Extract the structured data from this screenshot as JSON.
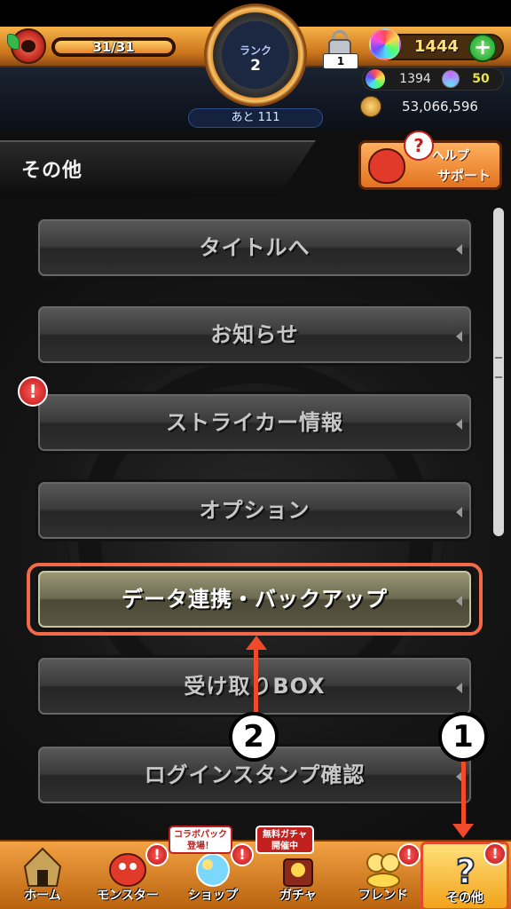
{
  "status": {
    "stamina": "31/31",
    "stamina_fraction": 1.0,
    "rank_label": "ランク",
    "rank_value": "2",
    "next_rank": "あと 111",
    "lock_count": "1",
    "orbs": "1444",
    "plus": "+",
    "sub_orbs": "1394",
    "shards": "50",
    "coins": "53,066,596"
  },
  "header": {
    "title": "その他",
    "help_line1": "ヘルプ",
    "help_line2": "サポート",
    "help_q": "?"
  },
  "menu": {
    "items": [
      {
        "label": "タイトルへ"
      },
      {
        "label": "お知らせ"
      },
      {
        "label": "ストライカー情報"
      },
      {
        "label": "オプション"
      },
      {
        "label": "データ連携・バックアップ"
      },
      {
        "label": "受け取りBOX"
      },
      {
        "label": "ログインスタンプ確認"
      }
    ],
    "alert": "!"
  },
  "annotations": {
    "step1": "1",
    "step2": "2"
  },
  "nav": {
    "items": [
      {
        "label": "ホーム"
      },
      {
        "label": "モンスター"
      },
      {
        "label": "ショップ"
      },
      {
        "label": "ガチャ"
      },
      {
        "label": "フレンド"
      },
      {
        "label": "その他"
      }
    ],
    "collab_tag": "コラボパック\n登場！",
    "gacha_tag": "無料ガチャ\n開催中",
    "badge": "!"
  },
  "colors": {
    "accent_orange": "#f3a244",
    "highlight_red": "#f26a4a",
    "orb_yellow": "#ffe27a"
  }
}
